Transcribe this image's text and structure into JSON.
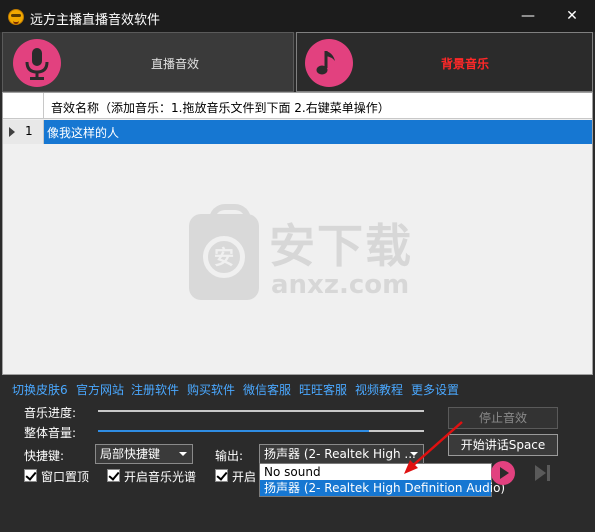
{
  "window": {
    "title": "远方主播直播音效软件",
    "min_glyph": "—",
    "close_glyph": "✕"
  },
  "tabs": [
    {
      "label": "直播音效",
      "icon": "microphone-icon",
      "active": false
    },
    {
      "label": "背景音乐",
      "icon": "music-note-icon",
      "active": true
    }
  ],
  "colors": {
    "accent_pink": "#e2417f",
    "selection_blue": "#1677d2",
    "link_blue": "#4aa8ff",
    "active_tab_text": "#ff2828"
  },
  "list": {
    "column_header": "音效名称（添加音乐：1.拖放音乐文件到下面   2.右键菜单操作）",
    "rows": [
      {
        "index": "1",
        "name": "像我这样的人",
        "selected": true
      }
    ]
  },
  "watermark": {
    "logo_glyph": "安",
    "text": "安下载",
    "domain": "anxz.com"
  },
  "links": [
    "切换皮肤6",
    "官方网站",
    "注册软件",
    "购买软件",
    "微信客服",
    "旺旺客服",
    "视频教程",
    "更多设置"
  ],
  "controls": {
    "progress_label": "音乐进度:",
    "volume_label": "整体音量:",
    "volume_level": 0.83,
    "hotkey_label": "快捷键:",
    "hotkey_value": "局部快捷键",
    "output_label": "输出:",
    "output_value": "扬声器 (2- Realtek High ...",
    "output_options": [
      "No sound",
      "扬声器 (2- Realtek High Definition Audio)"
    ],
    "stop_button": "停止音效",
    "talk_button": "开始讲话Space",
    "checkboxes": [
      {
        "label": "窗口置顶",
        "checked": true
      },
      {
        "label": "开启音乐光谱",
        "checked": true
      },
      {
        "label": "开启",
        "checked": true
      }
    ]
  }
}
